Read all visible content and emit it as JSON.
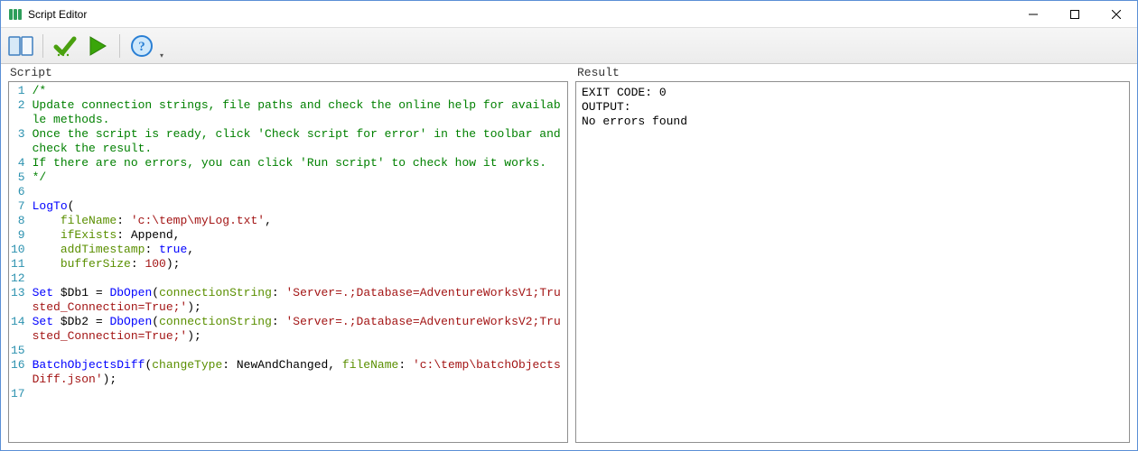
{
  "window": {
    "title": "Script Editor"
  },
  "toolbar": {
    "icons": {
      "panels": "panels-icon",
      "check": "check-icon",
      "run": "run-icon",
      "help": "help-icon"
    }
  },
  "panels": {
    "script_label": "Script",
    "result_label": "Result"
  },
  "script": {
    "lines": [
      {
        "n": 1,
        "t": "comment",
        "text": "/*"
      },
      {
        "n": 2,
        "t": "comment",
        "text": "Update connection strings, file paths and check the online help for available methods."
      },
      {
        "n": 3,
        "t": "comment",
        "text": "Once the script is ready, click 'Check script for error' in the toolbar and check the result."
      },
      {
        "n": 4,
        "t": "comment",
        "text": "If there are no errors, you can click 'Run script' to check how it works."
      },
      {
        "n": 5,
        "t": "comment",
        "text": "*/"
      },
      {
        "n": 6,
        "t": "blank",
        "text": ""
      },
      {
        "n": 7,
        "t": "call_open",
        "func": "LogTo",
        "tail": "("
      },
      {
        "n": 8,
        "t": "param",
        "name": "fileName",
        "value_str": "'c:\\temp\\myLog.txt'",
        "tail": ","
      },
      {
        "n": 9,
        "t": "param",
        "name": "ifExists",
        "value_plain": "Append",
        "tail": ","
      },
      {
        "n": 10,
        "t": "param",
        "name": "addTimestamp",
        "value_key": "true",
        "tail": ","
      },
      {
        "n": 11,
        "t": "param",
        "name": "bufferSize",
        "value_num": "100",
        "tail": ");"
      },
      {
        "n": 12,
        "t": "blank",
        "text": ""
      },
      {
        "n": 13,
        "t": "setdb",
        "var": "$Db1",
        "func": "DbOpen",
        "param": "connectionString",
        "value_str": "'Server=.;Database=AdventureWorksV1;Trusted_Connection=True;'",
        "tail": ");"
      },
      {
        "n": 14,
        "t": "setdb",
        "var": "$Db2",
        "func": "DbOpen",
        "param": "connectionString",
        "value_str": "'Server=.;Database=AdventureWorksV2;Trusted_Connection=True;'",
        "tail": ");"
      },
      {
        "n": 15,
        "t": "blank",
        "text": ""
      },
      {
        "n": 16,
        "t": "batch",
        "func": "BatchObjectsDiff",
        "p1": "changeType",
        "v1_plain": "NewAndChanged",
        "p2": "fileName",
        "v2_str": "'c:\\temp\\batchObjectsDiff.json'",
        "tail": ");"
      },
      {
        "n": 17,
        "t": "blank",
        "text": ""
      }
    ]
  },
  "result": {
    "text": "EXIT CODE: 0\nOUTPUT:\nNo errors found"
  }
}
